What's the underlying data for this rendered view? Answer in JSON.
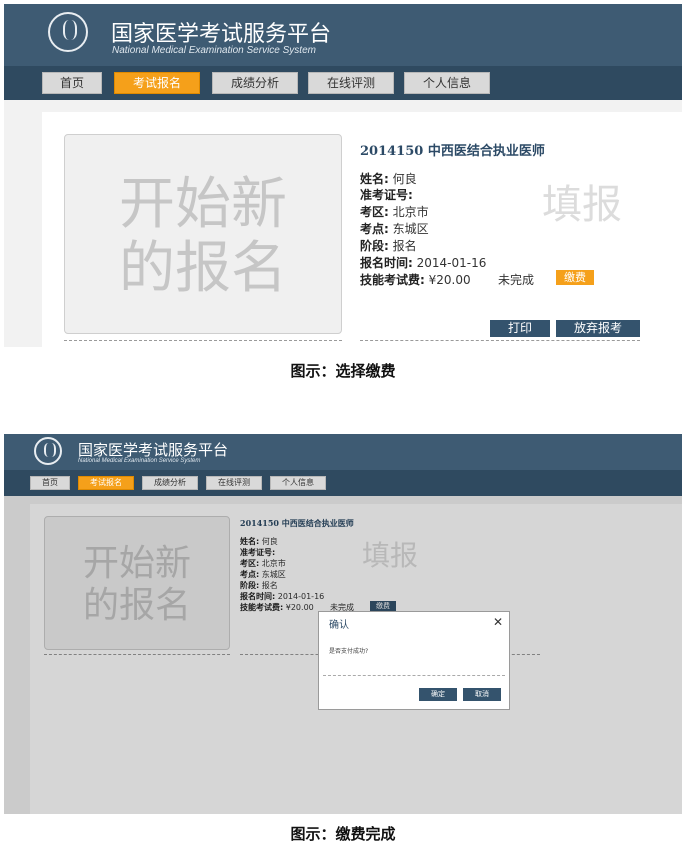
{
  "header": {
    "title_cn": "国家医学考试服务平台",
    "title_en": "National Medical Examination Service System",
    "logo_icon": "medical-emblem-icon"
  },
  "nav": {
    "items": [
      {
        "label": "首页"
      },
      {
        "label": "考试报名",
        "active": true
      },
      {
        "label": "成绩分析"
      },
      {
        "label": "在线评测"
      },
      {
        "label": "个人信息"
      }
    ]
  },
  "card": {
    "placeholder_line1": "开始新",
    "placeholder_line2": "的报名",
    "exam_title": "2014150 中西医结合执业医师",
    "stamp": "填报",
    "fields": [
      {
        "label": "姓名:",
        "value": "何良"
      },
      {
        "label": "准考证号:",
        "value": ""
      },
      {
        "label": "考区:",
        "value": "北京市"
      },
      {
        "label": "考点:",
        "value": "东城区"
      },
      {
        "label": "阶段:",
        "value": "报名"
      },
      {
        "label": "报名时间:",
        "value": "2014-01-16"
      },
      {
        "label": "技能考试费:",
        "value": "¥20.00"
      }
    ],
    "fee_status": "未完成",
    "pay_label": "缴费",
    "print_label": "打印",
    "abandon_label": "放弃报考"
  },
  "dialog": {
    "title": "确认",
    "message": "是否支付成功?",
    "confirm_label": "确定",
    "cancel_label": "取消",
    "close_icon": "close-icon"
  },
  "captions": {
    "first": "图示：选择缴费",
    "second": "图示：缴费完成"
  },
  "colors": {
    "header_bg": "#3e5b73",
    "nav_bg": "#2f4a60",
    "accent": "#f5a01a",
    "button_dark": "#34536d"
  }
}
